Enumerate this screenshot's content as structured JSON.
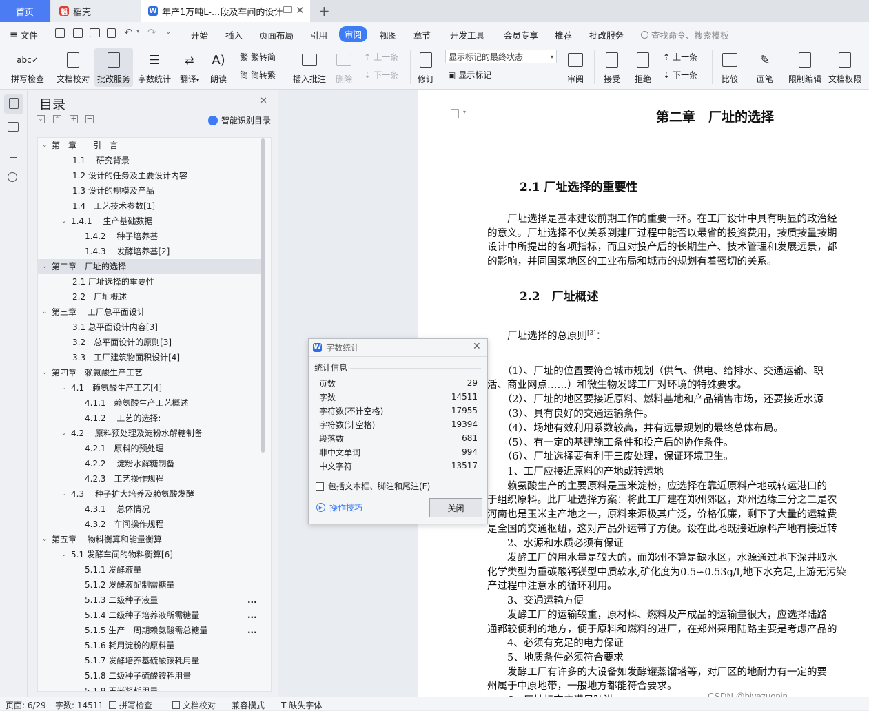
{
  "tabs": {
    "home": "首页",
    "daoke": "稻壳",
    "doc": "年产1万吨L-...段及车间的设计",
    "new_tab": "+"
  },
  "menu": {
    "file": "文件",
    "items": [
      "开始",
      "插入",
      "页面布局",
      "引用",
      "审阅",
      "视图",
      "章节",
      "开发工具",
      "会员专享",
      "推荐",
      "批改服务"
    ],
    "search": "查找命令、搜索模板"
  },
  "ribbon": {
    "spellcheck": "拼写检查",
    "doc_check": "文档校对",
    "correction": "批改服务",
    "word_count": "字数统计",
    "translate": "翻译",
    "read_aloud": "朗读",
    "trad": "繁转简",
    "simp": "简转繁",
    "insert_comment": "插入批注",
    "delete": "删除",
    "prev": "上一条",
    "next": "下一条",
    "revise": "修订",
    "markup_select": "显示标记的最终状态",
    "show_markup": "显示标记",
    "review": "审阅",
    "accept": "接受",
    "reject": "拒绝",
    "prev2": "上一条",
    "next2": "下一条",
    "compare": "比较",
    "pen": "画笔",
    "restrict": "限制编辑",
    "rights": "文档权限"
  },
  "toc": {
    "title": "目录",
    "smart": "智能识别目录",
    "items": [
      {
        "t": "第一章　　引　言",
        "lvl": 0,
        "chev": true
      },
      {
        "t": "1.1　 研究背景",
        "lvl": 1
      },
      {
        "t": "1.2  设计的任务及主要设计内容",
        "lvl": 1
      },
      {
        "t": "1.3  设计的规模及产品",
        "lvl": 1
      },
      {
        "t": "1.4　工艺技术参数[1]",
        "lvl": 1
      },
      {
        "t": "1.4.1　 生产基础数据",
        "lvl": 1,
        "chev": true
      },
      {
        "t": "1.4.2　  种子培养基",
        "lvl": 2
      },
      {
        "t": "1.4.3　  发酵培养基[2]",
        "lvl": 2
      },
      {
        "t": "第二章　厂址的选择",
        "lvl": 0,
        "chev": true,
        "sel": true
      },
      {
        "t": "2.1  厂址选择的重要性",
        "lvl": 1
      },
      {
        "t": "2.2　厂址概述",
        "lvl": 1
      },
      {
        "t": "第三章　 工厂总平面设计",
        "lvl": 0,
        "chev": true
      },
      {
        "t": "3.1 总平面设计内容[3]",
        "lvl": 1
      },
      {
        "t": "3.2　总平面设计的原则[3]",
        "lvl": 1
      },
      {
        "t": "3.3　工厂建筑物面积设计[4]",
        "lvl": 1
      },
      {
        "t": "第四章　赖氨酸生产工艺",
        "lvl": 0,
        "chev": true
      },
      {
        "t": "4.1　赖氨酸生产工艺[4]",
        "lvl": 1,
        "chev": true
      },
      {
        "t": "4.1.1　赖氨酸生产工艺概述",
        "lvl": 2
      },
      {
        "t": "4.1.2　 工艺的选择:",
        "lvl": 2
      },
      {
        "t": "4.2　 原料预处理及淀粉水解糖制备",
        "lvl": 1,
        "chev": true
      },
      {
        "t": "4.2.1　原料的预处理",
        "lvl": 2
      },
      {
        "t": "4.2.2　 淀粉水解糖制备",
        "lvl": 2
      },
      {
        "t": "4.2.3　工艺操作规程",
        "lvl": 2
      },
      {
        "t": "4.3　 种子扩大培养及赖氨酸发酵",
        "lvl": 1,
        "chev": true
      },
      {
        "t": "4.3.1　 总体情况",
        "lvl": 2
      },
      {
        "t": "4.3.2　车间操作规程",
        "lvl": 2
      },
      {
        "t": "第五章　 物料衡算和能量衡算",
        "lvl": 0,
        "chev": true
      },
      {
        "t": "5.1 发酵车间的物料衡算[6]",
        "lvl": 1,
        "chev": true
      },
      {
        "t": "5.1.1 发酵液量",
        "lvl": 2
      },
      {
        "t": "5.1.2 发酵液配制需糖量",
        "lvl": 2
      },
      {
        "t": "5.1.3 二级种子液量",
        "lvl": 2,
        "more": true
      },
      {
        "t": "5.1.4 二级种子培养液所需糖量",
        "lvl": 2,
        "more": true
      },
      {
        "t": "5.1.5 生产一周期赖氨酸需总糖量",
        "lvl": 2,
        "more": true
      },
      {
        "t": "5.1.6  耗用淀粉的原料量",
        "lvl": 2
      },
      {
        "t": "5.1.7  发酵培养基硫酸铵耗用量",
        "lvl": 2
      },
      {
        "t": "5.1.8  二级种子硫酸铵耗用量",
        "lvl": 2
      },
      {
        "t": "5.1.9  玉米浆耗用量",
        "lvl": 2
      }
    ],
    "more_glyph": "..."
  },
  "document": {
    "chapter_title": "第二章　厂址的选择",
    "s21": "2.1  厂址选择的重要性",
    "p1": [
      "　　厂址选择是基本建设前期工作的重要一环。在工厂设计中具有明显的政治经",
      "的意义。厂址选择不仅关系到建厂过程中能否以最省的投资费用，按质按量按期",
      "设计中所提出的各项指标，而且对投产后的长期生产、技术管理和发展远景，都",
      "的影响，并同国家地区的工业布局和城市的规划有着密切的关系。"
    ],
    "s22": "2.2　厂址概述",
    "principle": "　　厂址选择的总原则",
    "principle_ref": "[3]",
    "principle_tail": "：",
    "lines": [
      "　　（1）、厂址的位置要符合城市规划（供气、供电、给排水、交通运输、职",
      "活、商业网点……）和微生物发酵工厂对环境的特殊要求。",
      "　　（2）、厂址的地区要接近原料、燃料基地和产品销售市场，还要接近水源",
      "　　（3）、具有良好的交通运输条件。",
      "　　（4）、场地有效利用系数较高，并有远景规划的最终总体布局。",
      "　　（5）、有一定的基建施工条件和投产后的协作条件。",
      "　　（6）、厂址选择要有利于三废处理，保证环境卫生。",
      "　　1、工厂应接近原料的产地或转运地",
      "　　赖氨酸生产的主要原料是玉米淀粉，应选择在靠近原料产地或转运港口的",
      "于组织原料。此厂址选择方案：将此工厂建在郑州郊区，郑州边缘三分之二是农",
      "河南也是玉米主产地之一，原料来源极其广泛，价格低廉，剩下了大量的运输费",
      "是全国的交通枢纽，这对产品外运带了方便。设在此地既接近原料产地有接近转",
      "　　2、水源和水质必须有保证",
      "　　发酵工厂的用水量是较大的，而郑州不算是缺水区，水源通过地下深井取水",
      "化学类型为重碳酸钙镁型中质软水,矿化度为0.5∽0.53g/l,地下水充足,上游无污染",
      "产过程中注意水的循环利用。",
      "　　3、交通运输方便",
      "　　发酵工厂的运输较重，原材料、燃料及产成品的运输量很大，应选择陆路",
      "通都较便利的地方，便于原料和燃料的进厂，在郑州采用陆路主要是考虑产品的",
      "　　4、必须有充足的电力保证",
      "　　5、地质条件必须符合要求",
      "　　发酵工厂有许多的大设备如发酵罐蒸馏塔等，对厂区的地耐力有一定的要",
      "州属于中原地带，一般地方都能符合要求。",
      "　　6、厂址标高应满足防洪"
    ]
  },
  "dialog": {
    "title": "字数统计",
    "section": "统计信息",
    "rows": [
      {
        "label": "页数",
        "value": "29"
      },
      {
        "label": "字数",
        "value": "14511"
      },
      {
        "label": "字符数(不计空格)",
        "value": "17955"
      },
      {
        "label": "字符数(计空格)",
        "value": "19394"
      },
      {
        "label": "段落数",
        "value": "681"
      },
      {
        "label": "非中文单词",
        "value": "994"
      },
      {
        "label": "中文字符",
        "value": "13517"
      }
    ],
    "checkbox": "包括文本框、脚注和尾注(F)",
    "tips": "操作技巧",
    "close": "关闭"
  },
  "status": {
    "page": "页面: 6/29",
    "words": "字数: 14511",
    "spell": "拼写检查",
    "doccheck": "文档校对",
    "compat": "兼容模式",
    "font": "缺失字体"
  },
  "watermark": "CSDN @biyezuopin",
  "colors": {
    "accent": "#3d7cf5",
    "tab_home": "#4b7cf3",
    "wps_red": "#e23b35"
  }
}
